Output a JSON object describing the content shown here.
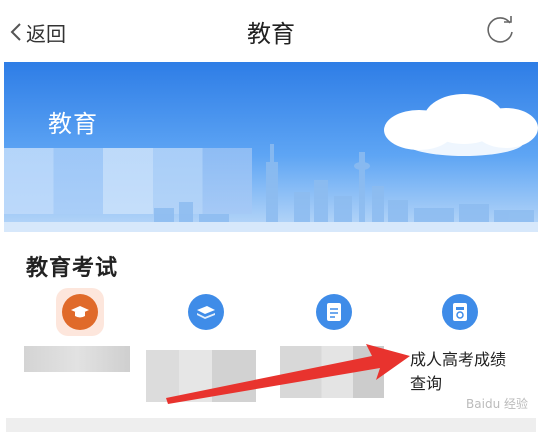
{
  "header": {
    "back_label": "返回",
    "title": "教育"
  },
  "banner": {
    "title": "教育"
  },
  "section": {
    "title": "教育考试"
  },
  "services": [
    {
      "icon": "graduation-cap-icon",
      "color": "#e06a2a",
      "label_obscured": true
    },
    {
      "icon": "book-icon",
      "color": "#3f8ce8",
      "label_obscured": true
    },
    {
      "icon": "document-icon",
      "color": "#3f8ce8",
      "label_obscured": true
    },
    {
      "icon": "score-document-icon",
      "color": "#3f8ce8",
      "label": "成人高考成绩查询"
    }
  ],
  "watermark": "Baidu 经验",
  "colors": {
    "accent": "#3f8ce8",
    "arrow": "#e8332e",
    "highlight_bg": "#fde6dc"
  }
}
